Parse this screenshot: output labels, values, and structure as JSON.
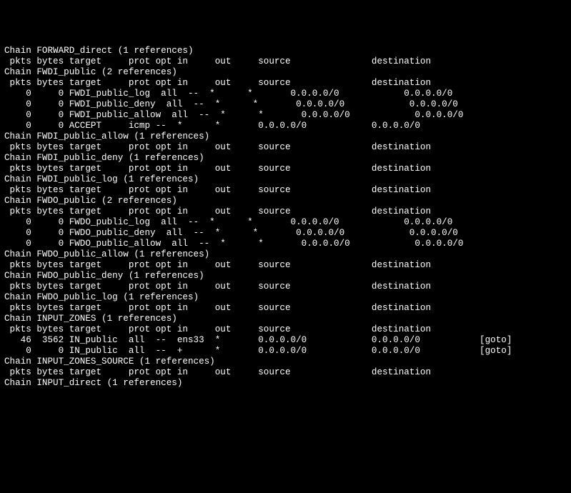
{
  "chains": [
    {
      "header": "Chain FORWARD_direct (1 references)",
      "col": " pkts bytes target     prot opt in     out     source               destination",
      "rows": []
    },
    {
      "header": "Chain FWDI_public (2 references)",
      "col": " pkts bytes target     prot opt in     out     source               destination",
      "rows": [
        "    0     0 FWDI_public_log  all  --  *      *       0.0.0.0/0            0.0.0.0/0",
        "    0     0 FWDI_public_deny  all  --  *      *       0.0.0.0/0            0.0.0.0/0",
        "    0     0 FWDI_public_allow  all  --  *      *       0.0.0.0/0            0.0.0.0/0",
        "    0     0 ACCEPT     icmp --  *      *       0.0.0.0/0            0.0.0.0/0"
      ]
    },
    {
      "header": "Chain FWDI_public_allow (1 references)",
      "col": " pkts bytes target     prot opt in     out     source               destination",
      "rows": []
    },
    {
      "header": "Chain FWDI_public_deny (1 references)",
      "col": " pkts bytes target     prot opt in     out     source               destination",
      "rows": []
    },
    {
      "header": "Chain FWDI_public_log (1 references)",
      "col": " pkts bytes target     prot opt in     out     source               destination",
      "rows": []
    },
    {
      "header": "Chain FWDO_public (2 references)",
      "col": " pkts bytes target     prot opt in     out     source               destination",
      "rows": [
        "    0     0 FWDO_public_log  all  --  *      *       0.0.0.0/0            0.0.0.0/0",
        "    0     0 FWDO_public_deny  all  --  *      *       0.0.0.0/0            0.0.0.0/0",
        "    0     0 FWDO_public_allow  all  --  *      *       0.0.0.0/0            0.0.0.0/0"
      ]
    },
    {
      "header": "Chain FWDO_public_allow (1 references)",
      "col": " pkts bytes target     prot opt in     out     source               destination",
      "rows": []
    },
    {
      "header": "Chain FWDO_public_deny (1 references)",
      "col": " pkts bytes target     prot opt in     out     source               destination",
      "rows": []
    },
    {
      "header": "Chain FWDO_public_log (1 references)",
      "col": " pkts bytes target     prot opt in     out     source               destination",
      "rows": []
    },
    {
      "header": "Chain INPUT_ZONES (1 references)",
      "col": " pkts bytes target     prot opt in     out     source               destination",
      "rows": [
        "   46  3562 IN_public  all  --  ens33  *       0.0.0.0/0            0.0.0.0/0           [goto]",
        "    0     0 IN_public  all  --  +      *       0.0.0.0/0            0.0.0.0/0           [goto]"
      ]
    },
    {
      "header": "Chain INPUT_ZONES_SOURCE (1 references)",
      "col": " pkts bytes target     prot opt in     out     source               destination",
      "rows": []
    },
    {
      "header": "Chain INPUT_direct (1 references)"
    }
  ]
}
